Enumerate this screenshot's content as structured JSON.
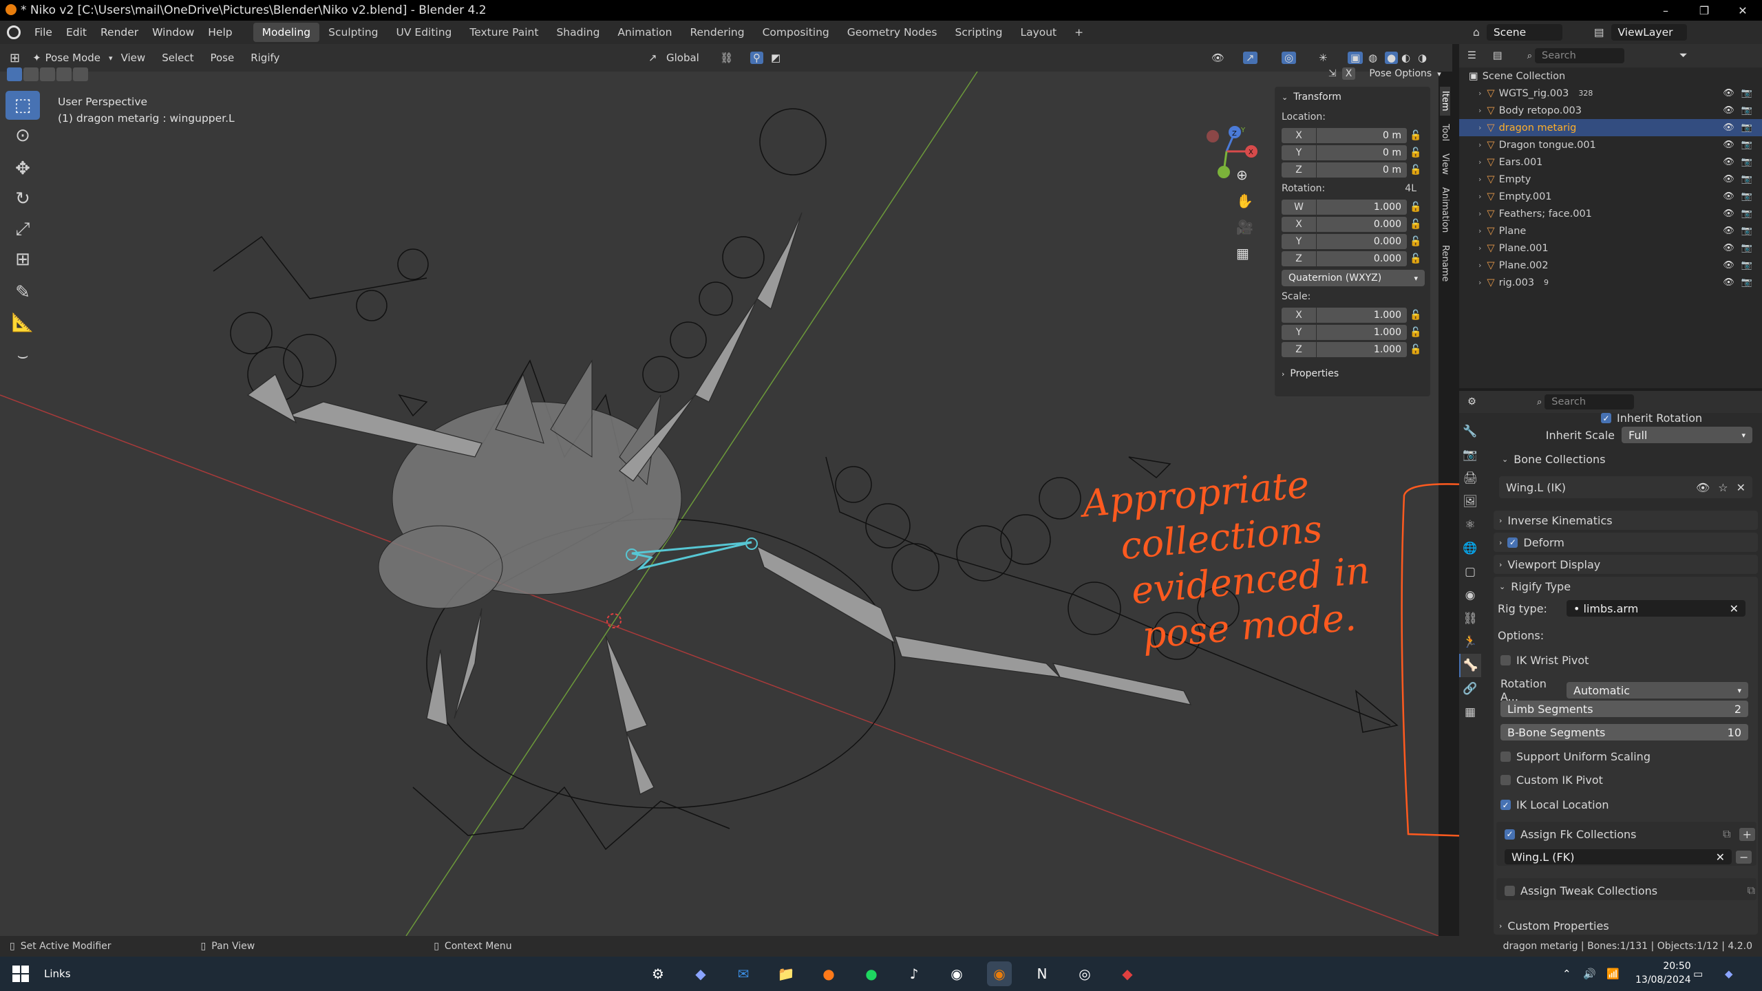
{
  "window": {
    "title": "* Niko v2 [C:\\Users\\mail\\OneDrive\\Pictures\\Blender\\Niko v2.blend] - Blender 4.2"
  },
  "menubar": {
    "menus": [
      "File",
      "Edit",
      "Render",
      "Window",
      "Help"
    ],
    "workspaces": [
      "Modeling",
      "Sculpting",
      "UV Editing",
      "Texture Paint",
      "Shading",
      "Animation",
      "Rendering",
      "Compositing",
      "Geometry Nodes",
      "Scripting",
      "Layout"
    ],
    "active_workspace": "Modeling",
    "scene": "Scene",
    "view_layer": "ViewLayer"
  },
  "viewport_header": {
    "mode": "Pose Mode",
    "menus": [
      "View",
      "Select",
      "Pose",
      "Rigify"
    ],
    "orientation": "Global",
    "pose_options": "Pose Options"
  },
  "viewport": {
    "perspective": "User Perspective",
    "active": "(1) dragon metarig : wingupper.L"
  },
  "npanel": {
    "tabs": [
      "Item",
      "Tool",
      "View",
      "Animation",
      "Rename"
    ],
    "transform_title": "Transform",
    "location_label": "Location:",
    "location": [
      {
        "axis": "X",
        "value": "0 m"
      },
      {
        "axis": "Y",
        "value": "0 m"
      },
      {
        "axis": "Z",
        "value": "0 m"
      }
    ],
    "rotation_label": "Rotation:",
    "rotation_mode_short": "4L",
    "rotation": [
      {
        "axis": "W",
        "value": "1.000"
      },
      {
        "axis": "X",
        "value": "0.000"
      },
      {
        "axis": "Y",
        "value": "0.000"
      },
      {
        "axis": "Z",
        "value": "0.000"
      }
    ],
    "rotation_mode": "Quaternion (WXYZ)",
    "scale_label": "Scale:",
    "scale": [
      {
        "axis": "X",
        "value": "1.000"
      },
      {
        "axis": "Y",
        "value": "1.000"
      },
      {
        "axis": "Z",
        "value": "1.000"
      }
    ],
    "properties_title": "Properties"
  },
  "outliner": {
    "search_placeholder": "Search",
    "root": "Scene Collection",
    "items": [
      {
        "name": "WGTS_rig.003",
        "badge": "328"
      },
      {
        "name": "Body retopo.003"
      },
      {
        "name": "dragon metarig",
        "selected": true
      },
      {
        "name": "Dragon tongue.001"
      },
      {
        "name": "Ears.001"
      },
      {
        "name": "Empty"
      },
      {
        "name": "Empty.001"
      },
      {
        "name": "Feathers; face.001"
      },
      {
        "name": "Plane"
      },
      {
        "name": "Plane.001"
      },
      {
        "name": "Plane.002"
      },
      {
        "name": "rig.003",
        "badge": "9"
      }
    ]
  },
  "properties": {
    "search_placeholder": "Search",
    "inherit_rotation": "Inherit Rotation",
    "inherit_scale_label": "Inherit Scale",
    "inherit_scale_value": "Full",
    "bone_collections_title": "Bone Collections",
    "bone_collection_item": "Wing.L (IK)",
    "sections": [
      "Inverse Kinematics",
      "Deform",
      "Viewport Display",
      "Rigify Type"
    ],
    "rig_type_label": "Rig type:",
    "rig_type_value": "limbs.arm",
    "options_label": "Options:",
    "ik_wrist_pivot": "IK Wrist Pivot",
    "rotation_axis_label": "Rotation A...",
    "rotation_axis_value": "Automatic",
    "limb_segments_label": "Limb Segments",
    "limb_segments_value": "2",
    "bbone_segments_label": "B-Bone Segments",
    "bbone_segments_value": "10",
    "support_uniform_scaling": "Support Uniform Scaling",
    "custom_ik_pivot": "Custom IK Pivot",
    "ik_local_location": "IK Local Location",
    "assign_fk_collections": "Assign Fk Collections",
    "fk_collection_item": "Wing.L (FK)",
    "assign_tweak_collections": "Assign Tweak Collections",
    "custom_properties": "Custom Properties"
  },
  "annotation": {
    "lines": [
      "Appropriate",
      "collections",
      "evidenced in",
      "pose mode."
    ]
  },
  "statusbar": {
    "left": "Set Active Modifier",
    "middle": "Pan View",
    "right": "Context Menu",
    "stats": "dragon metarig | Bones:1/131 | Objects:1/12 | 4.2.0"
  },
  "taskbar": {
    "links": "Links",
    "time": "20:50",
    "date": "13/08/2024"
  },
  "colors": {
    "accent": "#4772b3",
    "annotation": "#ff5a1f",
    "selected_text": "#ffaf29",
    "viewport_bg": "#393939"
  }
}
